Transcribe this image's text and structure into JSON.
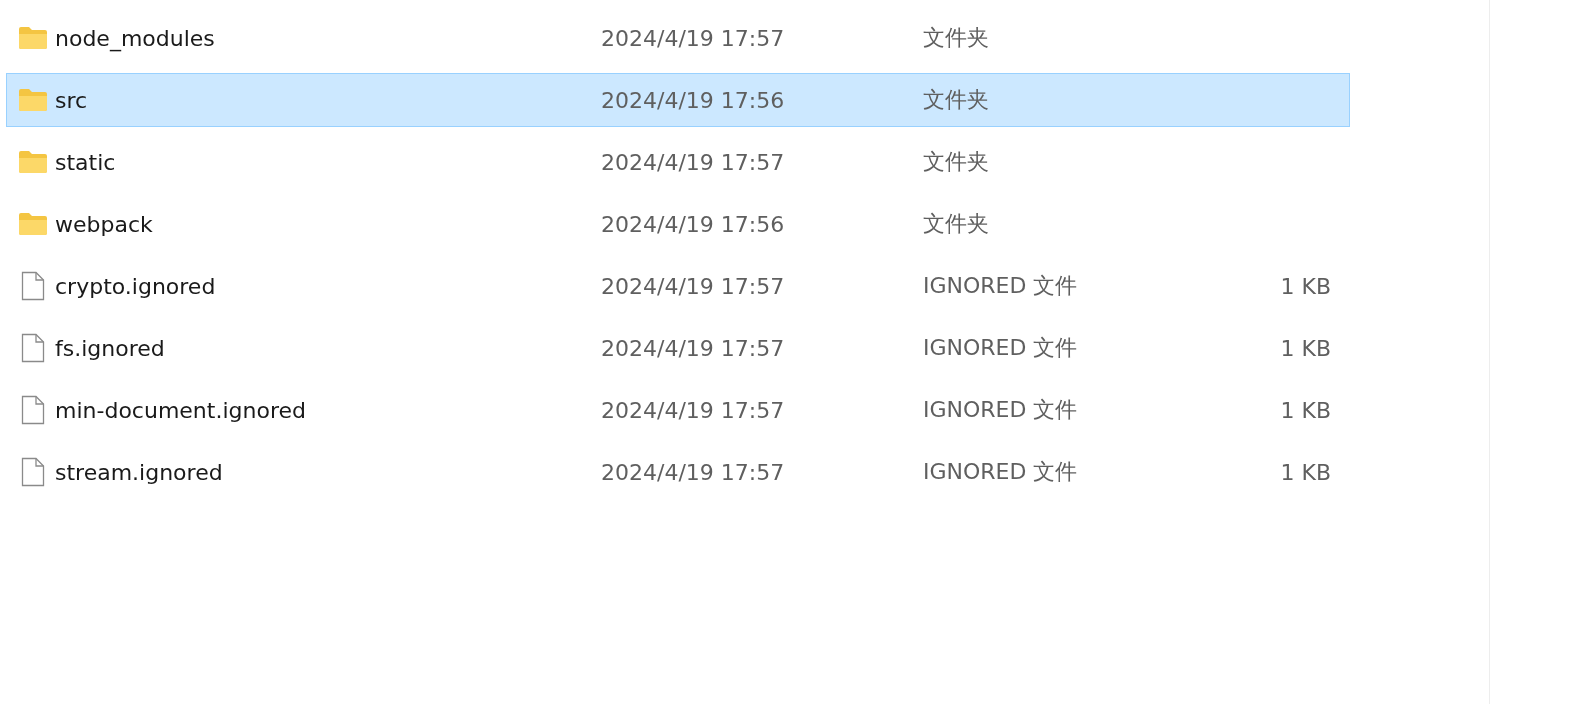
{
  "files": [
    {
      "kind": "folder",
      "name": "node_modules",
      "modified": "2024/4/19 17:57",
      "type": "文件夹",
      "selected": false
    },
    {
      "kind": "folder",
      "name": "src",
      "modified": "2024/4/19 17:56",
      "type": "文件夹",
      "selected": true
    },
    {
      "kind": "folder",
      "name": "static",
      "modified": "2024/4/19 17:57",
      "type": "文件夹",
      "selected": false
    },
    {
      "kind": "folder",
      "name": "webpack",
      "modified": "2024/4/19 17:56",
      "type": "文件夹",
      "selected": false
    },
    {
      "kind": "file",
      "name": "crypto.ignored",
      "modified": "2024/4/19 17:57",
      "type": "IGNORED 文件",
      "size": "1 KB",
      "selected": false
    },
    {
      "kind": "file",
      "name": "fs.ignored",
      "modified": "2024/4/19 17:57",
      "type": "IGNORED 文件",
      "size": "1 KB",
      "selected": false
    },
    {
      "kind": "file",
      "name": "min-document.ignored",
      "modified": "2024/4/19 17:57",
      "type": "IGNORED 文件",
      "size": "1 KB",
      "selected": false
    },
    {
      "kind": "file",
      "name": "stream.ignored",
      "modified": "2024/4/19 17:57",
      "type": "IGNORED 文件",
      "size": "1 KB",
      "selected": false
    }
  ]
}
